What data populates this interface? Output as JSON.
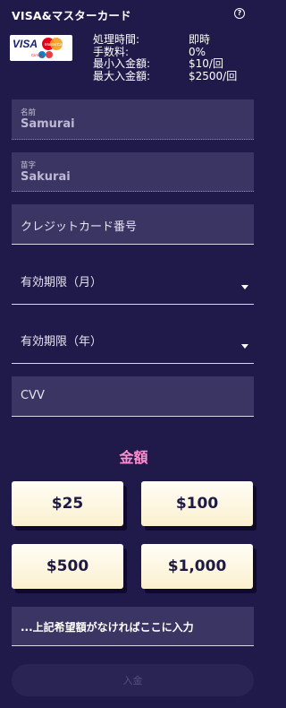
{
  "header": {
    "title": "VISA&マスターカード",
    "help_icon": "question-circle-icon"
  },
  "card_logo": {
    "visa": "VISA",
    "mastercard": "MasterCard",
    "cirrus": "Cirrus"
  },
  "info": [
    {
      "label": "処理時間:",
      "value": "即時"
    },
    {
      "label": "手数料:",
      "value": "0%"
    },
    {
      "label": "最小入金額:",
      "value": "$10/回"
    },
    {
      "label": "最大入金額:",
      "value": "$2500/回"
    }
  ],
  "form": {
    "first_name": {
      "label": "名前",
      "value": "Samurai"
    },
    "last_name": {
      "label": "苗字",
      "value": "Sakurai"
    },
    "card_number": {
      "placeholder": "クレジットカード番号"
    },
    "expiry_month": {
      "placeholder": "有効期限（月）"
    },
    "expiry_year": {
      "placeholder": "有効期限（年）"
    },
    "cvv": {
      "placeholder": "CVV"
    }
  },
  "amount": {
    "title": "金額",
    "options": [
      "$25",
      "$100",
      "$500",
      "$1,000"
    ],
    "custom_placeholder": "...上記希望額がなければここに入力"
  },
  "submit_label": "入金",
  "colors": {
    "background": "#201a4b",
    "field": "#3a3562",
    "accent": "#ff8fcf",
    "button": "#fbf0cf"
  }
}
